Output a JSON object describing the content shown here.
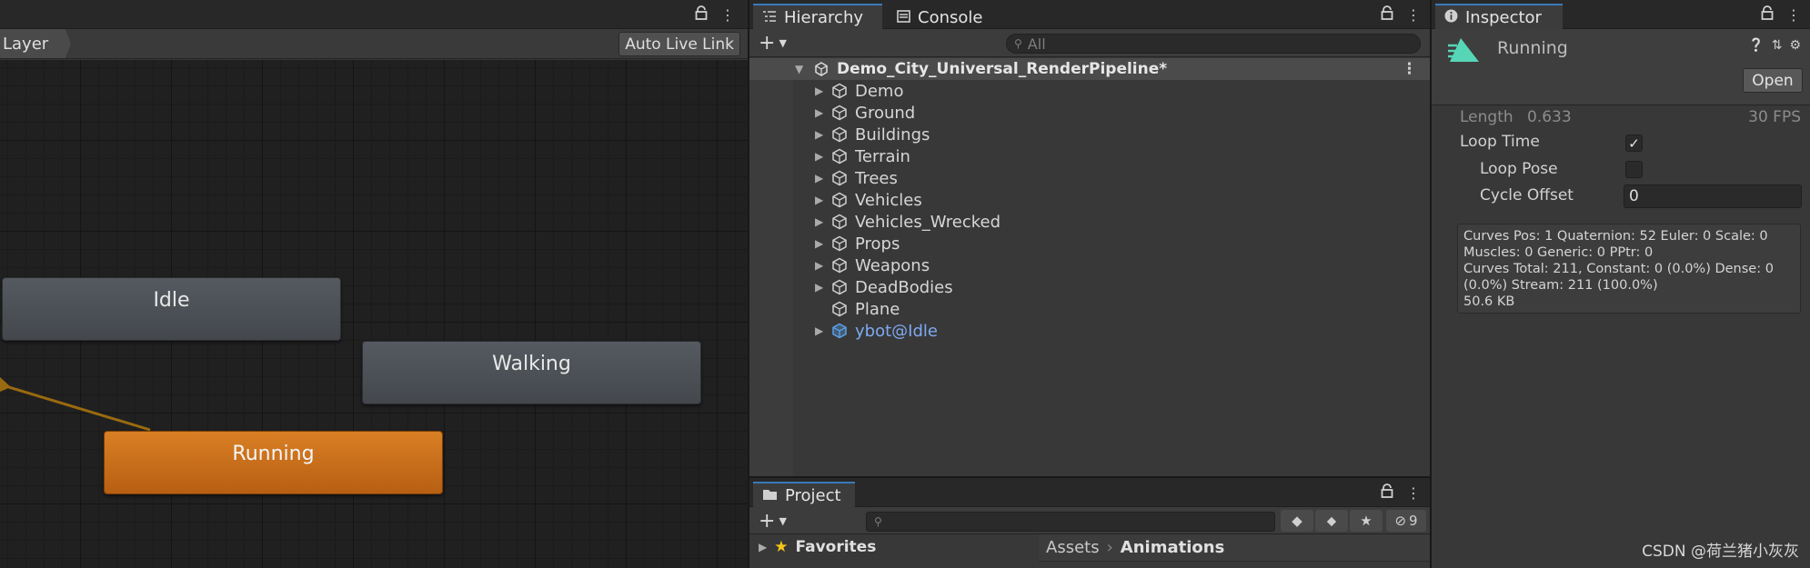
{
  "animator": {
    "layer_label": "Layer",
    "auto_live_link": "Auto Live Link",
    "states": {
      "idle": "Idle",
      "walking": "Walking",
      "running": "Running"
    }
  },
  "hierarchy": {
    "tabs": {
      "hierarchy": "Hierarchy",
      "console": "Console"
    },
    "search_placeholder": "All",
    "scene_name": "Demo_City_Universal_RenderPipeline*",
    "items": [
      {
        "label": "Demo",
        "expandable": true
      },
      {
        "label": "Ground",
        "expandable": true
      },
      {
        "label": "Buildings",
        "expandable": true
      },
      {
        "label": "Terrain",
        "expandable": true
      },
      {
        "label": "Trees",
        "expandable": true
      },
      {
        "label": "Vehicles",
        "expandable": true
      },
      {
        "label": "Vehicles_Wrecked",
        "expandable": true
      },
      {
        "label": "Props",
        "expandable": true
      },
      {
        "label": "Weapons",
        "expandable": true
      },
      {
        "label": "DeadBodies",
        "expandable": true
      },
      {
        "label": "Plane",
        "expandable": false
      },
      {
        "label": "ybot@Idle",
        "expandable": true,
        "prefab": true
      }
    ],
    "colors": {
      "prefab_text": "#7ea9f2"
    }
  },
  "project": {
    "tab": "Project",
    "hidden_count": "9",
    "favorites": "Favorites",
    "breadcrumb": {
      "root": "Assets",
      "current": "Animations"
    }
  },
  "inspector": {
    "tab": "Inspector",
    "clip_name": "Running",
    "open_button": "Open",
    "length_label": "Length",
    "length_value": "0.633",
    "fps": "30 FPS",
    "loop_time_label": "Loop Time",
    "loop_time_checked": true,
    "loop_pose_label": "Loop Pose",
    "loop_pose_checked": false,
    "cycle_offset_label": "Cycle Offset",
    "cycle_offset_value": "0",
    "info_lines": [
      "Curves Pos: 1 Quaternion: 52 Euler: 0 Scale: 0",
      "Muscles: 0 Generic: 0 PPtr: 0",
      "Curves Total: 211, Constant: 0 (0.0%) Dense: 0",
      "(0.0%) Stream: 211 (100.0%)",
      "50.6 KB"
    ],
    "check_glyph": "✓"
  },
  "watermark": "CSDN @荷兰猪小灰灰",
  "colors": {
    "active_tab": "#3a79bb",
    "running_state": "#c96d1a",
    "inspector_icon": "#57d6b7"
  }
}
